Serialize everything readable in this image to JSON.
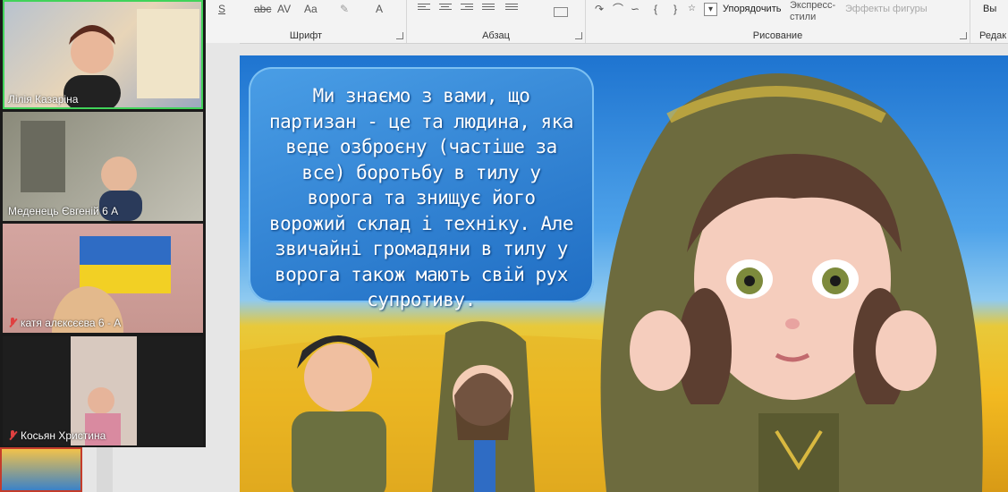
{
  "ribbon": {
    "groups": {
      "font_label": "Шрифт",
      "paragraph_label": "Абзац",
      "drawing_label": "Рисование",
      "editing_label_partial": "Редак"
    },
    "font_tools": [
      "S",
      "abc",
      "AV",
      "Aa",
      "A"
    ],
    "arrange_label": "Упорядочить",
    "express_styles_label": "Экспресс-\nстили",
    "shape_effects_label": "Эффекты фигуры",
    "select_label_partial": "Вы"
  },
  "video_panel": {
    "participants": [
      {
        "name": "Лілія Казаріна",
        "muted": false,
        "active": true
      },
      {
        "name": "Меденець Євгеній 6 А",
        "muted": false,
        "active": false
      },
      {
        "name": "катя алєксєєва 6 - А",
        "muted": true,
        "active": false
      },
      {
        "name": "Косьян Христина",
        "muted": true,
        "active": false
      }
    ]
  },
  "slide": {
    "text": "Ми знаємо з вами, що партизан - це та людина, яка веде озброєну (частіше за все) боротьбу в тилу у ворога та знищує його ворожий склад і техніку. Але звичайні громадяни в тилу у ворога також мають свій рух супротиву."
  },
  "colors": {
    "active_speaker": "#41d35a",
    "muted_icon": "#e04040",
    "slide_sky": "#1e74d0",
    "slide_field": "#f2b920",
    "textbox": "#2f84d8"
  }
}
